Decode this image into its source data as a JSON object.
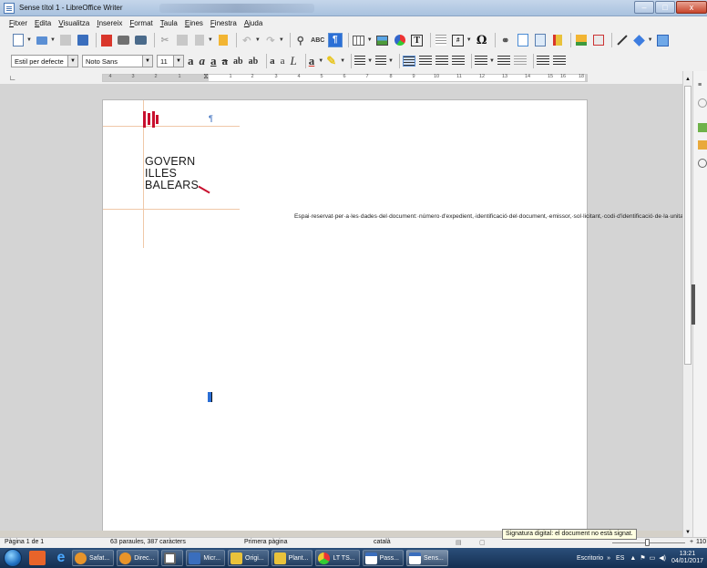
{
  "window": {
    "title": "Sense títol 1 - LibreOffice Writer"
  },
  "menu": [
    "Fitxer",
    "Edita",
    "Visualitza",
    "Insereix",
    "Format",
    "Taula",
    "Eines",
    "Finestra",
    "Ajuda"
  ],
  "format_bar": {
    "style": "Estil per defecte",
    "font": "Noto Sans",
    "size": "11"
  },
  "ruler": {
    "ticks": [
      "4",
      "3",
      "2",
      "1",
      "1",
      "2",
      "3",
      "4",
      "5",
      "6",
      "7",
      "8",
      "9",
      "10",
      "11",
      "12",
      "13",
      "14",
      "15",
      "16",
      "18"
    ]
  },
  "document": {
    "logo_lines": [
      "GOVERN",
      "ILLES",
      "BALEARS"
    ],
    "pilcrow": "¶",
    "text": "Espai·reservat·per·a·les·dades·del·document:·número·d'expedient,·identificació·del·document,·emissor,·sol·licitant,·codi·d'identificació·de·la·unitat,·codi·d'interoperabilitat,·metadades,·etc.¶",
    "accent_color": "#c8102e",
    "guide_color": "#f0c8a8"
  },
  "status": {
    "page": "Pàgina 1 de 1",
    "words": "63 paraules, 387 caràcters",
    "page_style": "Primera pàgina",
    "language": "català",
    "tooltip": "Signatura digital: el document no està signat.",
    "zoom": "110"
  },
  "taskbar": {
    "tasks": [
      "Safat...",
      "Direc...",
      "",
      "Micr...",
      "Origi...",
      "Plant...",
      "LT TS...",
      "Pass...",
      "Sens..."
    ],
    "desktop_label": "Escritorio",
    "lang": "ES",
    "time": "13:21",
    "date": "04/01/2017"
  }
}
